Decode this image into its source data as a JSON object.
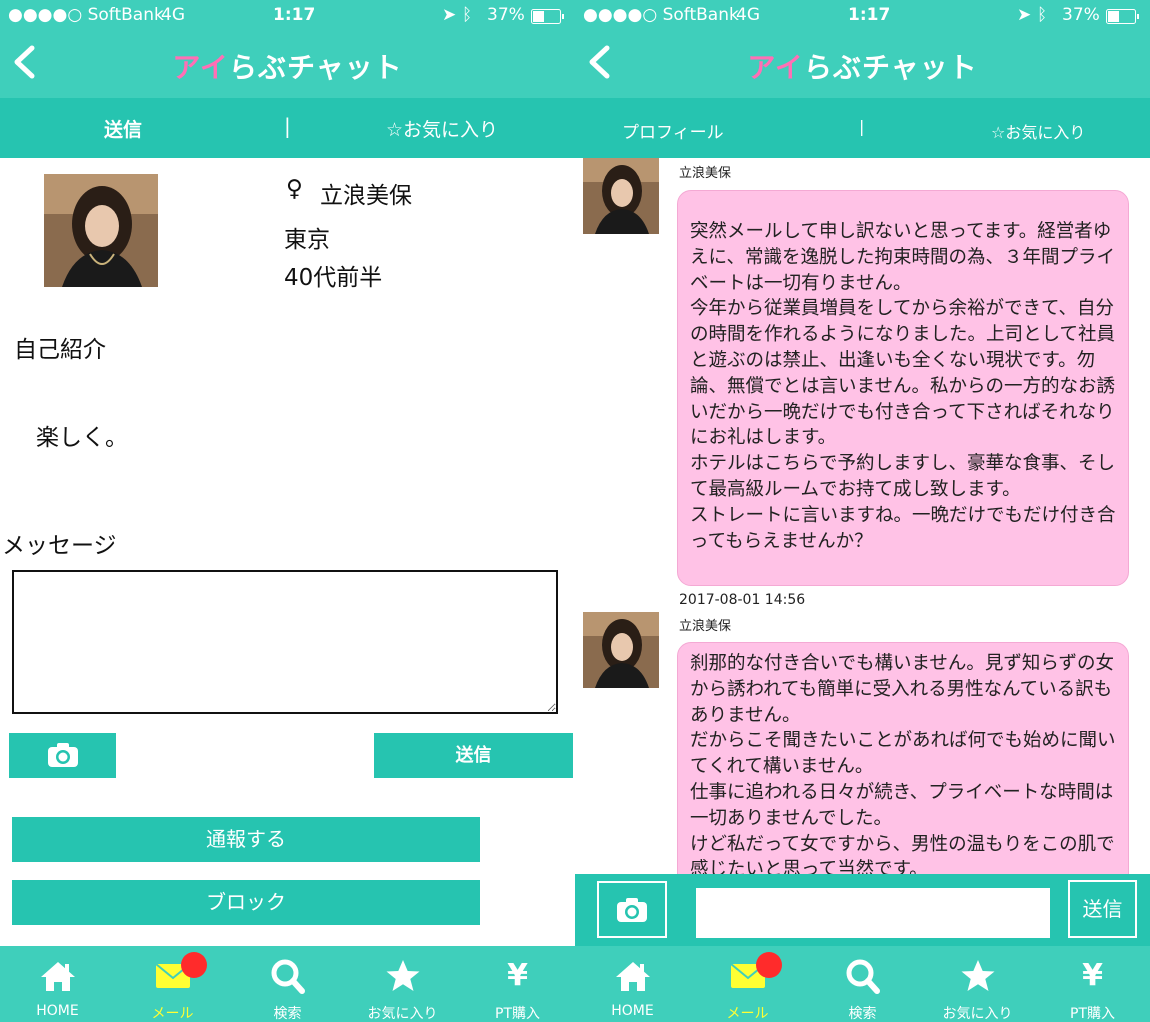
{
  "status_bar": {
    "carrier": "●●●●○ SoftBank",
    "network": "4G",
    "time": "1:17",
    "battery": "37%"
  },
  "app": {
    "logo_pink": "アイ",
    "logo_white": "らぶチャット"
  },
  "bottom_nav": [
    {
      "label": "HOME",
      "icon": "home-icon"
    },
    {
      "label": "メール",
      "icon": "mail-icon"
    },
    {
      "label": "検索",
      "icon": "search-icon"
    },
    {
      "label": "お気に入り",
      "icon": "star-icon"
    },
    {
      "label": "PT購入",
      "icon": "yen-icon"
    }
  ],
  "left": {
    "tabs": {
      "left": "送信",
      "separator": "|",
      "right": "☆お気に入り"
    },
    "profile": {
      "gender_symbol": "♀",
      "name": "立浪美保",
      "location": "東京",
      "age": "40代前半",
      "intro_heading": "自己紹介",
      "intro_text": "楽しく。"
    },
    "message_heading": "メッセージ",
    "send_label": "送信",
    "report_label": "通報する",
    "block_label": "ブロック"
  },
  "right": {
    "tabs": {
      "left": "プロフィール",
      "separator": "|",
      "right": "☆お気に入り"
    },
    "messages": [
      {
        "sender": "立浪美保",
        "timestamp": "",
        "text": "突然メールして申し訳ないと思ってます。経営者ゆえに、常識を逸脱した拘束時間の為、３年間プライベートは一切有りません。\n今年から従業員増員をしてから余裕ができて、自分の時間を作れるようになりました。上司として社員と遊ぶのは禁止、出逢いも全くない現状です。勿論、無償でとは言いません。私からの一方的なお誘いだから一晩だけでも付き合って下さればそれなりにお礼はします。\nホテルはこちらで予約しますし、豪華な食事、そして最高級ルームでお持て成し致します。\nストレートに言いますね。一晩だけでもだけ付き合ってもらえませんか？"
      },
      {
        "sender": "立浪美保",
        "timestamp": "2017-08-01 14:56",
        "text": "刹那的な付き合いでも構いません。見ず知らずの女から誘われても簡単に受入れる男性なんている訳もありません。\nだからこそ聞きたいことがあれば何でも始めに聞いてくれて構いません。\n仕事に追われる日々が続き、プライベートな時間は一切ありませんでした。\nけど私だって女ですから、男性の温もりをこの肌で感じたいと思って当然です。"
      }
    ],
    "send_label": "送信"
  }
}
